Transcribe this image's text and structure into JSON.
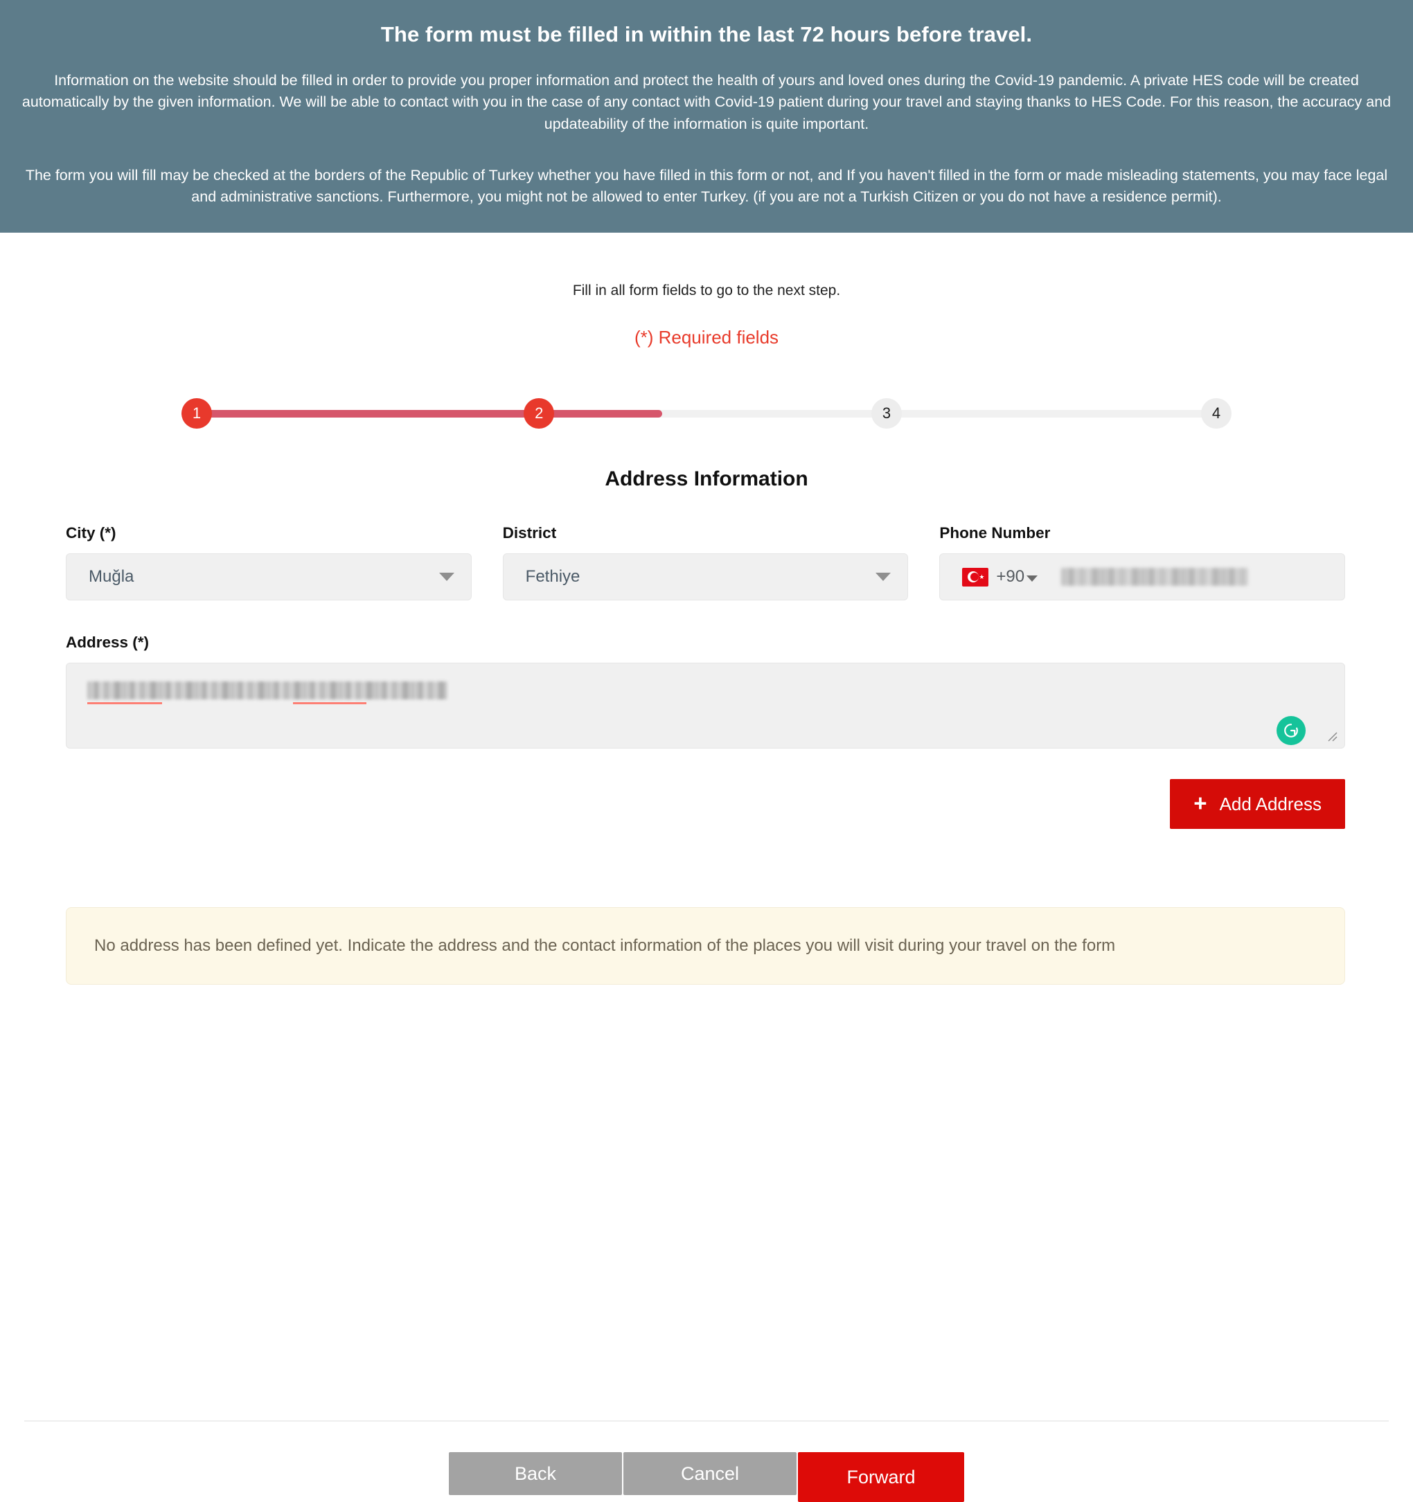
{
  "banner": {
    "title": "The form must be filled in within the last 72 hours before travel.",
    "paragraph1": "Information on the website should be filled in order to provide you proper information and protect the health of yours and loved ones during the Covid-19 pandemic. A private HES code will be created automatically by the given information. We will be able to contact with you in the case of any contact with Covid-19 patient during your travel and staying thanks to HES Code. For this reason, the accuracy and updateability of the information is quite important.",
    "paragraph2": "The form you will fill may be checked at the borders of the Republic of Turkey whether you have filled in this form or not, and If you haven't filled in the form or made misleading statements, you may face legal and administrative sanctions. Furthermore, you might not be allowed to enter Turkey. (if you are not a Turkish Citizen or you do not have a residence permit).",
    "bg_color": "#5d7c8a"
  },
  "instructions": {
    "hint": "Fill in all form fields to go to the next step.",
    "required_note": "(*) Required fields",
    "required_note_color": "#e83a2a"
  },
  "stepper": {
    "steps": [
      {
        "number": "1",
        "state": "done"
      },
      {
        "number": "2",
        "state": "done"
      },
      {
        "number": "3",
        "state": "todo"
      },
      {
        "number": "4",
        "state": "todo"
      }
    ],
    "active_color": "#e8392c",
    "fill_color": "#d6566b",
    "track_color": "#f1f1f1",
    "progress_percent": 46
  },
  "form": {
    "section_title": "Address Information",
    "city": {
      "label": "City (*)",
      "value": "Muğla",
      "icon": "chevron-down-icon"
    },
    "district": {
      "label": "District",
      "value": "Fethiye",
      "icon": "chevron-down-icon"
    },
    "phone": {
      "label": "Phone Number",
      "country_flag": "turkey-flag-icon",
      "dial_code": "+90",
      "value": "",
      "value_redacted": true
    },
    "address": {
      "label": "Address (*)",
      "value": "",
      "value_redacted": true,
      "grammarly_icon": "grammarly-icon",
      "resize_icon": "resize-handle-icon"
    },
    "add_address_button": {
      "label": "Add Address",
      "icon": "plus-icon",
      "color": "#d50c08"
    }
  },
  "alert": {
    "message": "No address has been defined yet. Indicate the address and the contact information of the places you will visit during your travel on the form",
    "bg_color": "#fdf8e7"
  },
  "footer": {
    "back_label": "Back",
    "cancel_label": "Cancel",
    "forward_label": "Forward",
    "forward_color": "#dd0b08",
    "secondary_color": "#a3a3a3"
  }
}
